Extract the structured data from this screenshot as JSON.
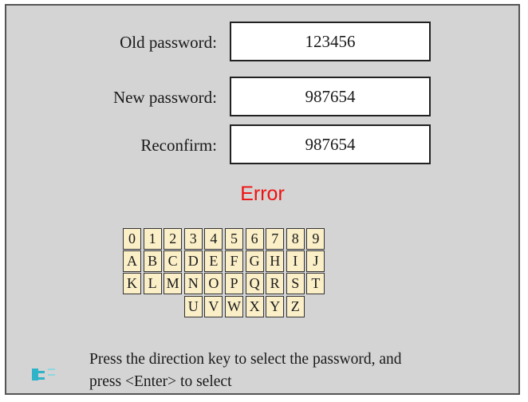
{
  "form": {
    "old_password_label": "Old password:",
    "old_password_value": "123456",
    "new_password_label": "New password:",
    "new_password_value": "987654",
    "reconfirm_label": "Reconfirm:",
    "reconfirm_value": "987654"
  },
  "status": {
    "message": "Error",
    "color": "#ee1111"
  },
  "keyboard": {
    "rows": [
      [
        "0",
        "1",
        "2",
        "3",
        "4",
        "5",
        "6",
        "7",
        "8",
        "9"
      ],
      [
        "A",
        "B",
        "C",
        "D",
        "E",
        "F",
        "G",
        "H",
        "I",
        "J"
      ],
      [
        "K",
        "L",
        "M",
        "N",
        "O",
        "P",
        "Q",
        "R",
        "S",
        "T"
      ],
      [
        "U",
        "V",
        "W",
        "X",
        "Y",
        "Z"
      ]
    ],
    "key_color": "#fbefc8"
  },
  "hint": {
    "icon": "direction-key-icon",
    "line1": "Press the direction key to select the password, and",
    "line2": "press <Enter> to select"
  }
}
